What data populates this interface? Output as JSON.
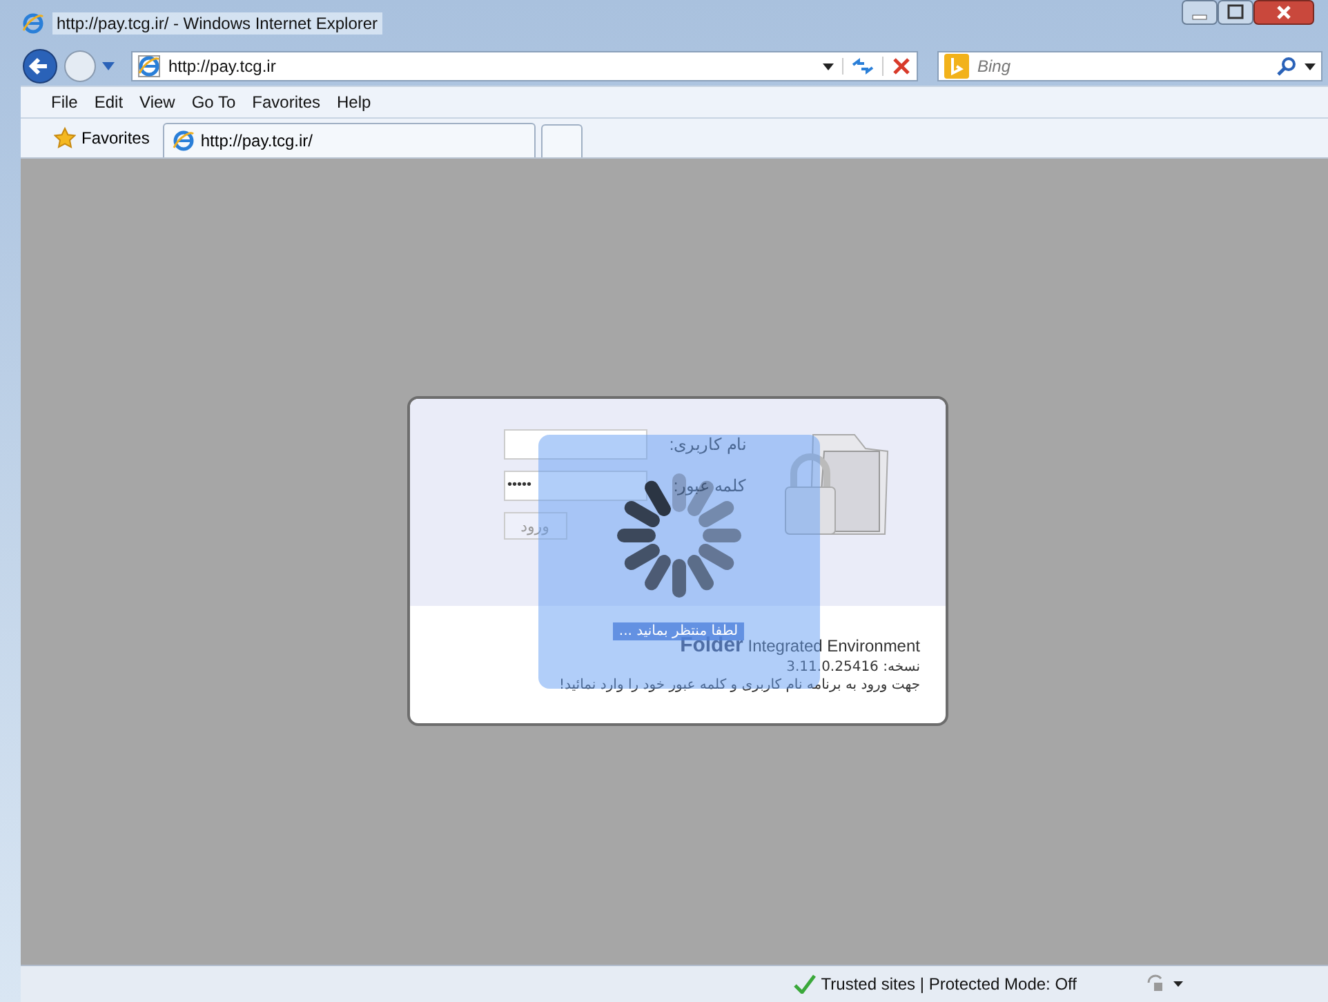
{
  "window": {
    "title": "http://pay.tcg.ir/ - Windows Internet Explorer"
  },
  "address_bar": {
    "url": "http://pay.tcg.ir"
  },
  "search": {
    "placeholder": "Bing"
  },
  "menu": [
    "File",
    "Edit",
    "View",
    "Go To",
    "Favorites",
    "Help"
  ],
  "favorites_bar": {
    "label": "Favorites"
  },
  "tabs": [
    {
      "label": "http://pay.tcg.ir/",
      "selected": true
    }
  ],
  "login": {
    "username_label": "نام کاربری:",
    "password_label": "کلمه عبور:",
    "password_value": "•••••",
    "login_button": "ورود",
    "product_name": "Folder",
    "product_subtitle": "Integrated Environment",
    "version": "نسخه: 3.11.0.25416",
    "instructions": "جهت ورود به برنامه نام کاربری و کلمه عبور خود را وارد نمائید!"
  },
  "loading": {
    "message": "لطفا منتظر بمانید ..."
  },
  "status_bar": {
    "zone": "Trusted sites | Protected Mode: Off"
  }
}
